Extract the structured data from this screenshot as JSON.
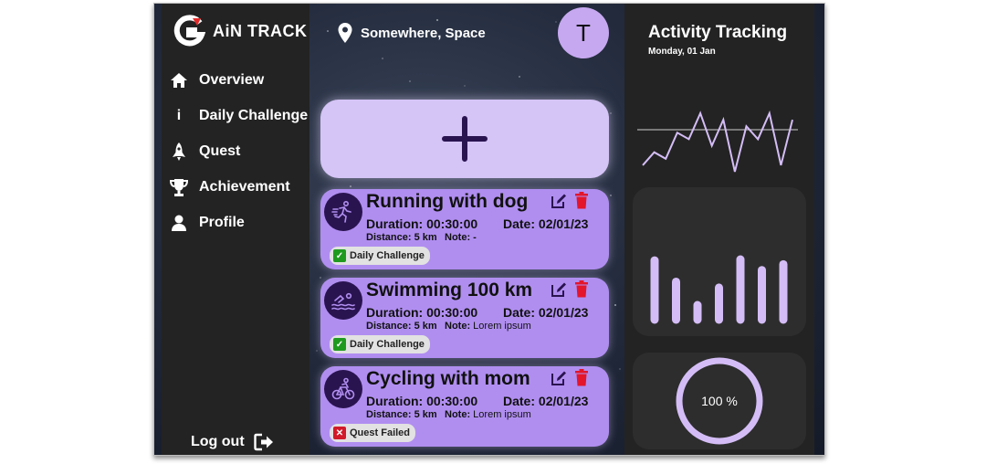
{
  "app": {
    "logo_letter": "G",
    "logo_text": "AiN TRACK"
  },
  "sidebar": {
    "items": [
      {
        "label": "Overview",
        "icon": "home-icon"
      },
      {
        "label": "Daily Challenge",
        "icon": "info-icon",
        "icon_glyph": "i"
      },
      {
        "label": "Quest",
        "icon": "rocket-icon"
      },
      {
        "label": "Achievement",
        "icon": "trophy-icon"
      },
      {
        "label": "Profile",
        "icon": "user-icon"
      }
    ],
    "logout_label": "Log out"
  },
  "header": {
    "location": "Somewhere, Space",
    "avatar_initial": "T"
  },
  "activities": [
    {
      "title": "Running with dog",
      "duration_label": "Duration:",
      "duration": "00:30:00",
      "date_label": "Date:",
      "date": "02/01/23",
      "distance_label": "Distance:",
      "distance": "5 km",
      "note_label": "Note:",
      "note": "-",
      "status": "Daily Challenge",
      "status_ok": true,
      "icon": "running-icon"
    },
    {
      "title": "Swimming 100 km",
      "duration_label": "Duration:",
      "duration": "00:30:00",
      "date_label": "Date:",
      "date": "02/01/23",
      "distance_label": "Distance:",
      "distance": "5 km",
      "note_label": "Note:",
      "note": "Lorem ipsum",
      "status": "Daily Challenge",
      "status_ok": true,
      "icon": "swimming-icon"
    },
    {
      "title": "Cycling with mom",
      "duration_label": "Duration:",
      "duration": "00:30:00",
      "date_label": "Date:",
      "date": "02/01/23",
      "distance_label": "Distance:",
      "distance": "5 km",
      "note_label": "Note:",
      "note": "Lorem ipsum",
      "status": "Quest Failed",
      "status_ok": false,
      "icon": "cycling-icon"
    }
  ],
  "right_panel": {
    "title": "Activity Tracking",
    "date": "Monday, 01 Jan",
    "progress_text": "100 %",
    "progress_percent": 100
  },
  "charts": {
    "line": {
      "type": "line",
      "values": [
        1,
        3,
        2,
        6,
        5,
        9,
        4,
        8,
        0,
        7,
        5,
        9,
        1,
        8
      ]
    },
    "bar": {
      "type": "bar",
      "values": [
        61,
        39,
        15,
        33,
        62,
        51,
        57
      ]
    }
  },
  "colors": {
    "accent": "#b08ef0",
    "accent_light": "#d5c4f6",
    "panel": "#232323",
    "ok": "#1f9a1f",
    "fail": "#d11a2a",
    "chart": "#d4bdf6"
  }
}
